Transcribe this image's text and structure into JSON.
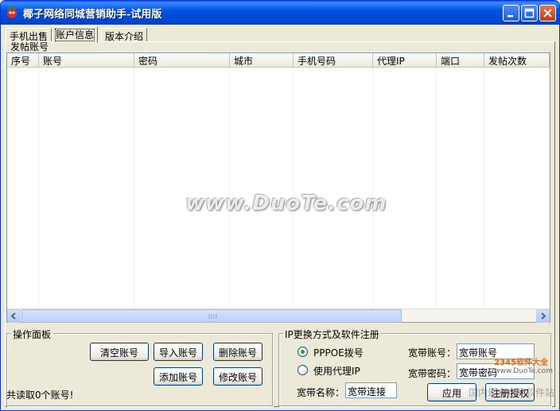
{
  "window": {
    "title": "椰子网络同城营销助手-试用版",
    "buttons": {
      "minimize": "minimize",
      "maximize": "maximize",
      "close": "close"
    }
  },
  "tabs": [
    {
      "label": "手机出售"
    },
    {
      "label": "账户信息",
      "active": true
    },
    {
      "label": "版本介绍"
    }
  ],
  "accounts_group": {
    "title": "发帖账号",
    "columns": [
      "序号",
      "账号",
      "密码",
      "城市",
      "手机号码",
      "代理IP",
      "端口",
      "发帖次数"
    ],
    "rows": []
  },
  "watermark": "www.DuoTe.com",
  "operations": {
    "title": "操作面板",
    "clear_label": "清空账号",
    "import_label": "导入账号",
    "delete_label": "删除账号",
    "add_label": "添加账号",
    "modify_label": "修改账号",
    "status": "共读取0个账号!"
  },
  "ip_group": {
    "title": "IP更换方式及软件注册",
    "pppoe_label": "PPPOE拨号",
    "proxy_label": "使用代理IP",
    "selected": "PPPOE拨号",
    "broadband_name_label": "宽带名称：",
    "broadband_name_value": "宽带连接",
    "broadband_account_label": "宽带账号：",
    "broadband_account_value": "宽带账号",
    "broadband_password_label": "宽带密码：",
    "broadband_password_value": "宽带密码",
    "apply_label": "应用",
    "register_label": "注册授权"
  },
  "corner_logo": "2345软件大全",
  "corner_logo_url": "www.DuoTe.com",
  "corner_overlay": "国内最安全的软件站"
}
